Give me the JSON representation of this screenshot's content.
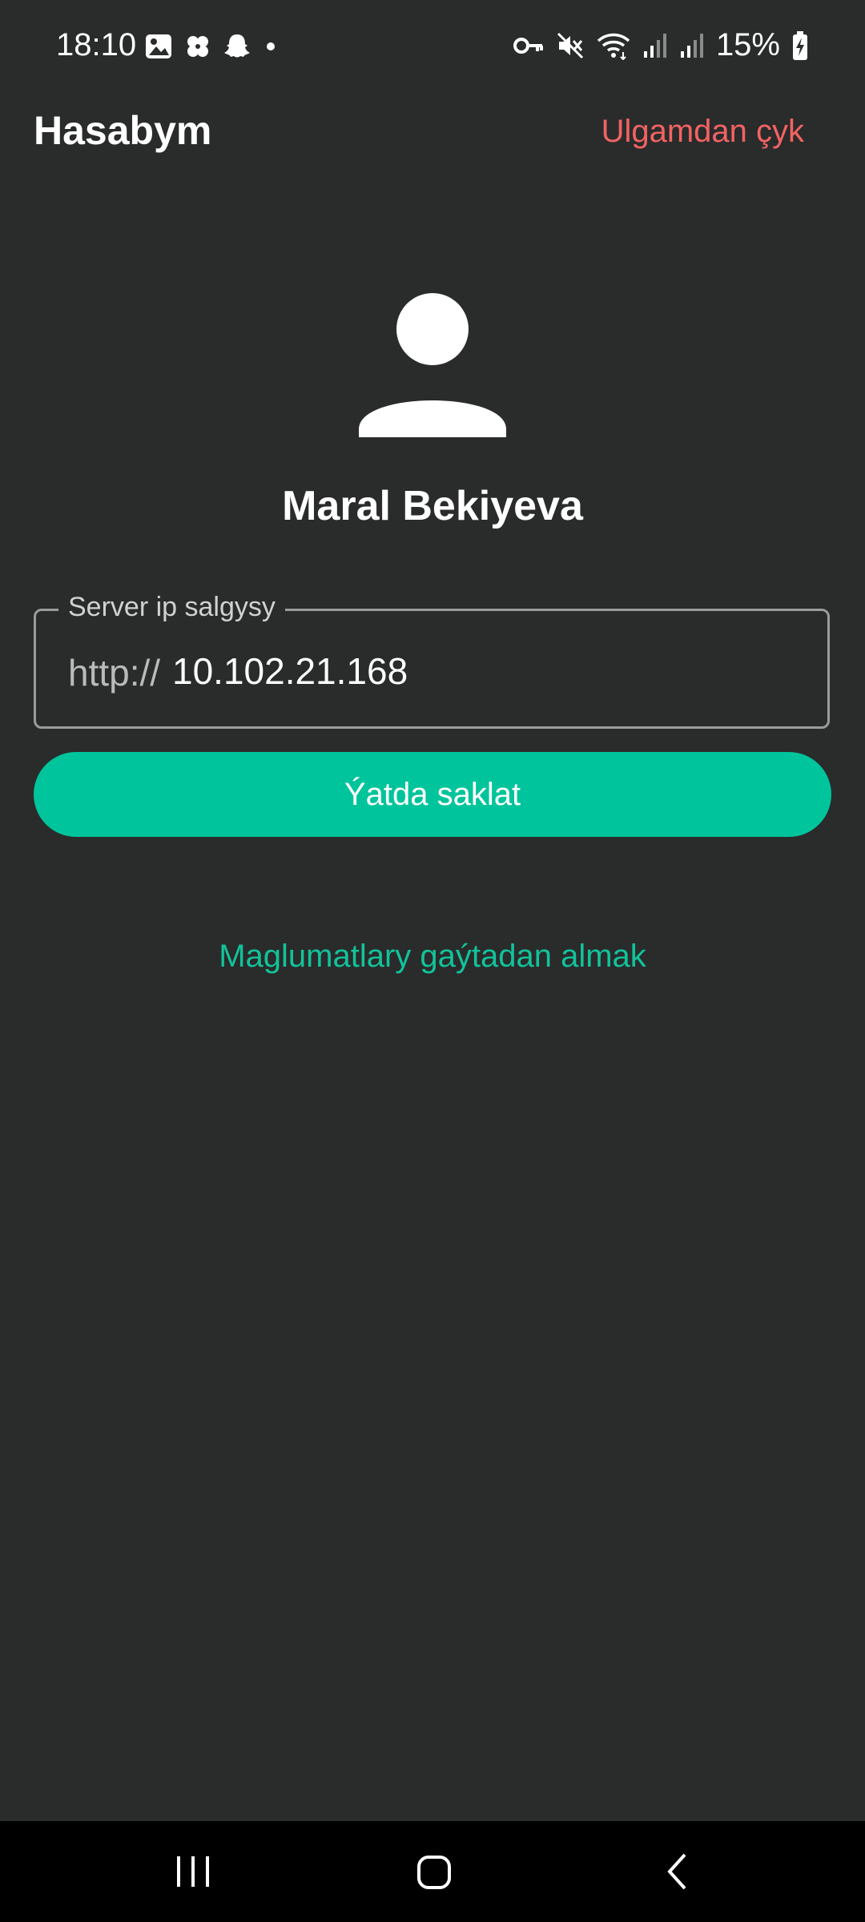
{
  "status_bar": {
    "time": "18:10",
    "battery": "15%",
    "icons_left": [
      "gallery-icon",
      "pinwheel-icon",
      "snapchat-ghost-icon",
      "dot-icon"
    ],
    "icons_right": [
      "key-icon",
      "mute-icon",
      "wifi-icon",
      "signal-icon",
      "signal-icon",
      "battery-charging-icon"
    ]
  },
  "header": {
    "title": "Hasabym",
    "logout_label": "Ulgamdan çyk"
  },
  "profile": {
    "avatar_icon": "person-icon",
    "name": "Maral Bekiyeva"
  },
  "server_field": {
    "label": "Server ip salgysy",
    "prefix": "http://",
    "value": "10.102.21.168"
  },
  "actions": {
    "save_label": "Ýatda saklat",
    "reload_label": "Maglumatlary gaýtadan almak"
  },
  "colors": {
    "background": "#2a2b2b",
    "accent": "#00c49b",
    "danger": "#f26363",
    "nav_bar": "#000000"
  },
  "nav_bar": {
    "icons": [
      "recents-icon",
      "home-icon",
      "back-icon"
    ]
  }
}
